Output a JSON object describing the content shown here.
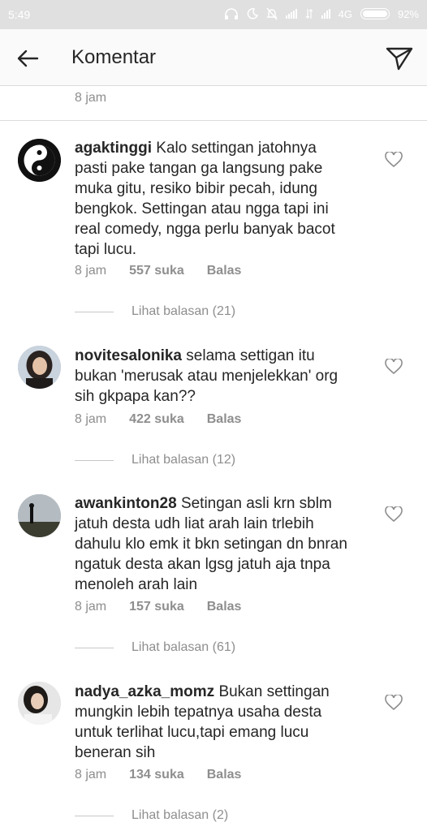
{
  "status_bar": {
    "time": "5:49",
    "network": "4G",
    "battery": "92%"
  },
  "header": {
    "title": "Komentar"
  },
  "top_timestamp": "8 jam",
  "comments": [
    {
      "username": "agaktinggi",
      "text": "Kalo settingan jatohnya pasti pake tangan ga langsung pake muka gitu, resiko bibir pecah, idung bengkok. Settingan atau ngga tapi ini real comedy, ngga perlu banyak bacot tapi lucu.",
      "time": "8 jam",
      "likes": "557 suka",
      "reply_label": "Balas",
      "view_replies": "Lihat balasan (21)"
    },
    {
      "username": "novitesalonika",
      "text": "selama settigan itu bukan 'merusak atau menjelekkan' org sih gkpapa kan??",
      "time": "8 jam",
      "likes": "422 suka",
      "reply_label": "Balas",
      "view_replies": "Lihat balasan (12)"
    },
    {
      "username": "awankinton28",
      "text": "Setingan asli krn sblm jatuh desta udh liat arah lain trlebih dahulu klo emk it bkn setingan dn bnran ngatuk desta akan lgsg jatuh aja tnpa menoleh arah lain",
      "time": "8 jam",
      "likes": "157 suka",
      "reply_label": "Balas",
      "view_replies": "Lihat balasan (61)"
    },
    {
      "username": "nadya_azka_momz",
      "text": "Bukan settingan mungkin lebih tepatnya usaha desta untuk terlihat lucu,tapi emang lucu beneran sih",
      "time": "8 jam",
      "likes": "134 suka",
      "reply_label": "Balas",
      "view_replies": "Lihat balasan (2)"
    }
  ],
  "icons": {
    "back": "arrow-left-icon",
    "send": "paper-plane-icon",
    "like": "heart-icon"
  },
  "colors": {
    "text": "#262626",
    "muted": "#8e8e8e",
    "divider": "#dbdbdb"
  }
}
